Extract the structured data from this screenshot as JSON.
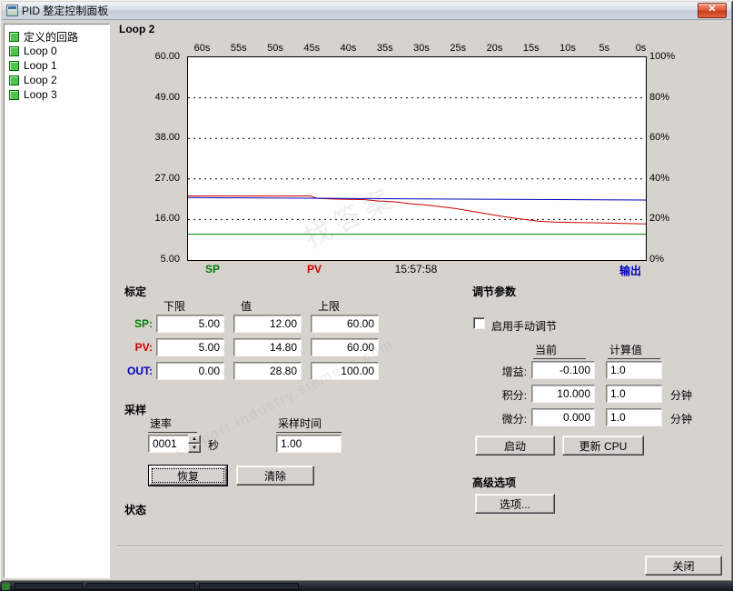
{
  "window": {
    "title": "PID 整定控制面板"
  },
  "icons": {
    "close": "✕",
    "spin_up": "▲",
    "spin_down": "▼"
  },
  "tree": {
    "items": [
      {
        "label": "定义的回路"
      },
      {
        "label": "Loop 0"
      },
      {
        "label": "Loop 1"
      },
      {
        "label": "Loop 2"
      },
      {
        "label": "Loop 3"
      }
    ]
  },
  "main": {
    "loop_label": "Loop 2"
  },
  "chart_data": {
    "type": "line",
    "title": "Loop 2",
    "x_ticks": [
      "60s",
      "55s",
      "50s",
      "45s",
      "40s",
      "35s",
      "30s",
      "25s",
      "20s",
      "15s",
      "10s",
      "5s",
      "0s"
    ],
    "left_axis": {
      "ticks": [
        "60.00",
        "49.00",
        "38.00",
        "27.00",
        "16.00",
        "5.00"
      ],
      "min": 5,
      "max": 60
    },
    "right_axis": {
      "ticks": [
        "100%",
        "80%",
        "60%",
        "40%",
        "20%",
        "0%"
      ],
      "min": 0,
      "max": 100
    },
    "grid": "horizontal-dashed",
    "timestamp": "15:57:58",
    "series": [
      {
        "name": "SP",
        "color": "#008000",
        "axis": "left",
        "points": [
          [
            60,
            12
          ],
          [
            0,
            12
          ]
        ]
      },
      {
        "name": "PV",
        "color": "#cc0000",
        "axis": "left",
        "points": [
          [
            60,
            22.4
          ],
          [
            44,
            22.4
          ],
          [
            43,
            21.7
          ],
          [
            40,
            21.5
          ],
          [
            37,
            21.4
          ],
          [
            35,
            21.0
          ],
          [
            33,
            20.8
          ],
          [
            31,
            20.3
          ],
          [
            29,
            20.0
          ],
          [
            27,
            19.5
          ],
          [
            25,
            19.0
          ],
          [
            23,
            18.3
          ],
          [
            21,
            17.6
          ],
          [
            19,
            16.9
          ],
          [
            17,
            16.3
          ],
          [
            15,
            15.8
          ],
          [
            14,
            15.5
          ],
          [
            12,
            15.3
          ],
          [
            10,
            15.2
          ],
          [
            7,
            15.1
          ],
          [
            4,
            15.0
          ],
          [
            0,
            14.8
          ]
        ]
      },
      {
        "name": "输出",
        "color": "#0000bb",
        "axis": "right",
        "points": [
          [
            60,
            30.8
          ],
          [
            30,
            30.2
          ],
          [
            0,
            29.6
          ]
        ]
      }
    ],
    "legend": [
      {
        "label": "SP",
        "color": "#008000"
      },
      {
        "label": "PV",
        "color": "#cc0000"
      },
      {
        "label": "15:57:58",
        "color": "#000000"
      },
      {
        "label": "输出",
        "color": "#0000bb"
      }
    ]
  },
  "scaling": {
    "title": "标定",
    "headers": [
      "下限",
      "值",
      "上限"
    ],
    "rows": [
      {
        "label": "SP:",
        "color": "#008000",
        "low": "5.00",
        "value": "12.00",
        "high": "60.00"
      },
      {
        "label": "PV:",
        "color": "#cc0000",
        "low": "5.00",
        "value": "14.80",
        "high": "60.00"
      },
      {
        "label": "OUT:",
        "color": "#0000bb",
        "low": "0.00",
        "value": "28.80",
        "high": "100.00"
      }
    ]
  },
  "sampling": {
    "title": "采样",
    "rate_label": "速率",
    "rate_value": "0001",
    "rate_unit": "秒",
    "time_label": "采样时间",
    "time_value": "1.00",
    "restore_button": "恢复",
    "clear_button": "清除"
  },
  "status": {
    "title": "状态"
  },
  "tuning": {
    "title": "调节参数",
    "manual_checkbox_label": "启用手动调节",
    "headers": [
      "当前",
      "计算值"
    ],
    "rows": [
      {
        "label": "增益:",
        "current": "-0.100",
        "calculated": "1.0",
        "unit": ""
      },
      {
        "label": "积分:",
        "current": "10.000",
        "calculated": "1.0",
        "unit": "分钟"
      },
      {
        "label": "微分:",
        "current": "0.000",
        "calculated": "1.0",
        "unit": "分钟"
      }
    ],
    "start_button": "启动",
    "update_button": "更新 CPU"
  },
  "advanced": {
    "title": "高级选项",
    "options_button": "选项..."
  },
  "close_button": "关闭",
  "watermark": {
    "text_cn": "找答案",
    "text_url": "support.industry.siemens.com"
  }
}
